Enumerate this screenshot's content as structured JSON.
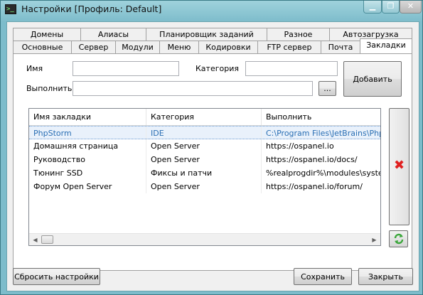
{
  "window": {
    "title": "Настройки [Профиль: Default]",
    "app_icon_glyph": ">_",
    "min_glyph": "▁",
    "max_glyph": "❐",
    "close_glyph": "✕"
  },
  "tabs_row1": [
    "Домены",
    "Алиасы",
    "Планировщик заданий",
    "Разное",
    "Автозагрузка"
  ],
  "tabs_row2": [
    "Основные",
    "Сервер",
    "Модули",
    "Меню",
    "Кодировки",
    "FTP сервер",
    "Почта",
    "Закладки"
  ],
  "active_tab": "Закладки",
  "form": {
    "name_label": "Имя",
    "name_value": "",
    "category_label": "Категория",
    "category_value": "",
    "execute_label": "Выполнить",
    "execute_value": "",
    "browse_label": "...",
    "add_label": "Добавить"
  },
  "bookmarks": {
    "columns": [
      "Имя закладки",
      "Категория",
      "Выполнить"
    ],
    "rows": [
      {
        "name": "PhpStorm",
        "category": "IDE",
        "execute": "C:\\Program Files\\JetBrains\\PhpSto",
        "selected": true
      },
      {
        "name": "Домашняя страница",
        "category": "Open Server",
        "execute": "https://ospanel.io"
      },
      {
        "name": "Руководство",
        "category": "Open Server",
        "execute": "https://ospanel.io/docs/"
      },
      {
        "name": "Тюнинг SSD",
        "category": "Фиксы и патчи",
        "execute": "%realprogdir%\\modules\\system\\"
      },
      {
        "name": "Форум Open Server",
        "category": "Open Server",
        "execute": "https://ospanel.io/forum/"
      }
    ],
    "scroll_left_glyph": "◀",
    "scroll_right_glyph": "▶",
    "delete_icon_glyph": "✖",
    "refresh_icon": "refresh-icon"
  },
  "footer": {
    "reset_label": "Сбросить настройки",
    "save_label": "Сохранить",
    "close_label": "Закрыть"
  },
  "colors": {
    "frame": "#7dbccb",
    "selected_text": "#2a6fb4",
    "delete_icon": "#e02020",
    "refresh_icon": "#3aa63a"
  }
}
